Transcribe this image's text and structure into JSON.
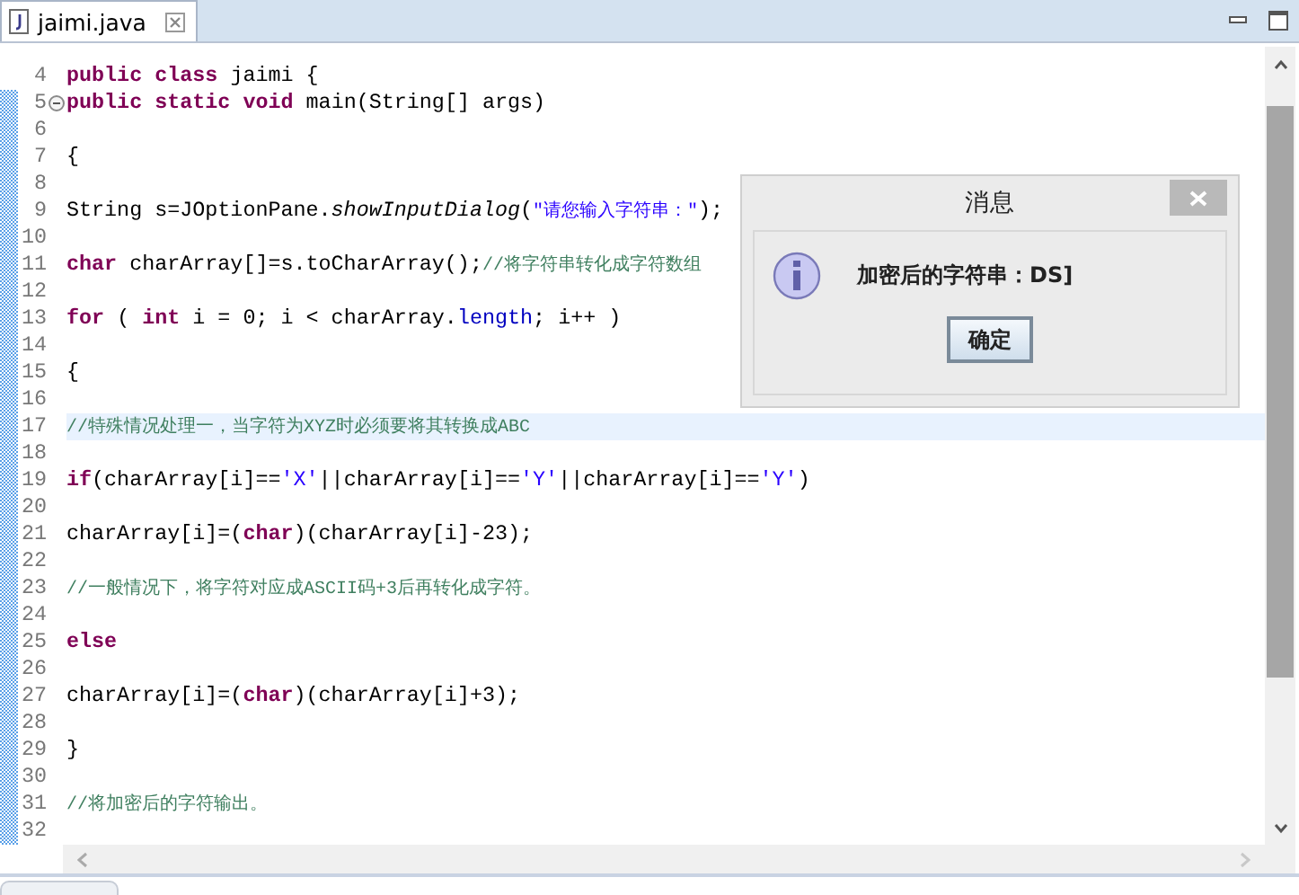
{
  "tabs": [
    {
      "label": "jaimi.java",
      "selected": true
    }
  ],
  "lines": [
    {
      "number": "4",
      "fold": false,
      "current": false,
      "tokens": [
        {
          "kind": "keyword",
          "text": "public "
        },
        {
          "kind": "keyword",
          "text": "class "
        },
        {
          "kind": "plain",
          "text": "jaimi {"
        }
      ]
    },
    {
      "number": "5",
      "fold": true,
      "current": false,
      "tokens": [
        {
          "kind": "keyword",
          "text": "public "
        },
        {
          "kind": "keyword",
          "text": "static "
        },
        {
          "kind": "keyword",
          "text": "void "
        },
        {
          "kind": "plain",
          "text": "main(String[] args)"
        }
      ]
    },
    {
      "number": "6",
      "fold": false,
      "current": false
    },
    {
      "number": "7",
      "fold": false,
      "current": false,
      "tokens": [
        {
          "kind": "plain",
          "text": "{"
        }
      ]
    },
    {
      "number": "8",
      "fold": false,
      "current": false
    },
    {
      "number": "9",
      "fold": false,
      "current": false,
      "tokens": [
        {
          "kind": "plain",
          "text": "String s=JOptionPane."
        },
        {
          "kind": "method",
          "text": "showInputDialog"
        },
        {
          "kind": "plain",
          "text": "("
        },
        {
          "kind": "string",
          "text": "\"请您输入字符串：\""
        },
        {
          "kind": "plain",
          "text": ");"
        }
      ]
    },
    {
      "number": "10",
      "fold": false,
      "current": false
    },
    {
      "number": "11",
      "fold": false,
      "current": false,
      "tokens": [
        {
          "kind": "keyword",
          "text": "char "
        },
        {
          "kind": "plain",
          "text": "charArray[]=s.toCharArray();"
        },
        {
          "kind": "comment",
          "text": "//将字符串转化成字符数组"
        }
      ]
    },
    {
      "number": "12",
      "fold": false,
      "current": false
    },
    {
      "number": "13",
      "fold": false,
      "current": false,
      "tokens": [
        {
          "kind": "keyword",
          "text": "for "
        },
        {
          "kind": "plain",
          "text": "( "
        },
        {
          "kind": "keyword",
          "text": "int "
        },
        {
          "kind": "plain",
          "text": "i = 0; i < charArray."
        },
        {
          "kind": "field",
          "text": "length"
        },
        {
          "kind": "plain",
          "text": "; i++ )"
        }
      ]
    },
    {
      "number": "14",
      "fold": false,
      "current": false
    },
    {
      "number": "15",
      "fold": false,
      "current": false,
      "tokens": [
        {
          "kind": "plain",
          "text": "{"
        }
      ]
    },
    {
      "number": "16",
      "fold": false,
      "current": false
    },
    {
      "number": "17",
      "fold": false,
      "current": true,
      "tokens": [
        {
          "kind": "comment",
          "text": "//特殊情况处理一，当字符为XYZ时必须要将其转换成ABC"
        }
      ]
    },
    {
      "number": "18",
      "fold": false,
      "current": false
    },
    {
      "number": "19",
      "fold": false,
      "current": false,
      "tokens": [
        {
          "kind": "keyword",
          "text": "if"
        },
        {
          "kind": "plain",
          "text": "(charArray[i]=="
        },
        {
          "kind": "char",
          "text": "'X'"
        },
        {
          "kind": "plain",
          "text": "||charArray[i]=="
        },
        {
          "kind": "char",
          "text": "'Y'"
        },
        {
          "kind": "plain",
          "text": "||charArray[i]=="
        },
        {
          "kind": "char",
          "text": "'Y'"
        },
        {
          "kind": "plain",
          "text": ")"
        }
      ]
    },
    {
      "number": "20",
      "fold": false,
      "current": false
    },
    {
      "number": "21",
      "fold": false,
      "current": false,
      "tokens": [
        {
          "kind": "plain",
          "text": "charArray[i]=("
        },
        {
          "kind": "keyword",
          "text": "char"
        },
        {
          "kind": "plain",
          "text": ")(charArray[i]-23);"
        }
      ]
    },
    {
      "number": "22",
      "fold": false,
      "current": false
    },
    {
      "number": "23",
      "fold": false,
      "current": false,
      "tokens": [
        {
          "kind": "comment",
          "text": "//一般情况下，将字符对应成ASCII码+3后再转化成字符。"
        }
      ]
    },
    {
      "number": "24",
      "fold": false,
      "current": false
    },
    {
      "number": "25",
      "fold": false,
      "current": false,
      "tokens": [
        {
          "kind": "keyword",
          "text": "else"
        }
      ]
    },
    {
      "number": "26",
      "fold": false,
      "current": false
    },
    {
      "number": "27",
      "fold": false,
      "current": false,
      "tokens": [
        {
          "kind": "plain",
          "text": "charArray[i]=("
        },
        {
          "kind": "keyword",
          "text": "char"
        },
        {
          "kind": "plain",
          "text": ")(charArray[i]+3);"
        }
      ]
    },
    {
      "number": "28",
      "fold": false,
      "current": false
    },
    {
      "number": "29",
      "fold": false,
      "current": false,
      "tokens": [
        {
          "kind": "plain",
          "text": "}"
        }
      ]
    },
    {
      "number": "30",
      "fold": false,
      "current": false
    },
    {
      "number": "31",
      "fold": false,
      "current": false,
      "tokens": [
        {
          "kind": "comment",
          "text": "//将加密后的字符输出。"
        }
      ]
    },
    {
      "number": "32",
      "fold": false,
      "current": false
    }
  ],
  "dialog": {
    "title": "消息",
    "message": "加密后的字符串：DS]",
    "button": "确定"
  }
}
